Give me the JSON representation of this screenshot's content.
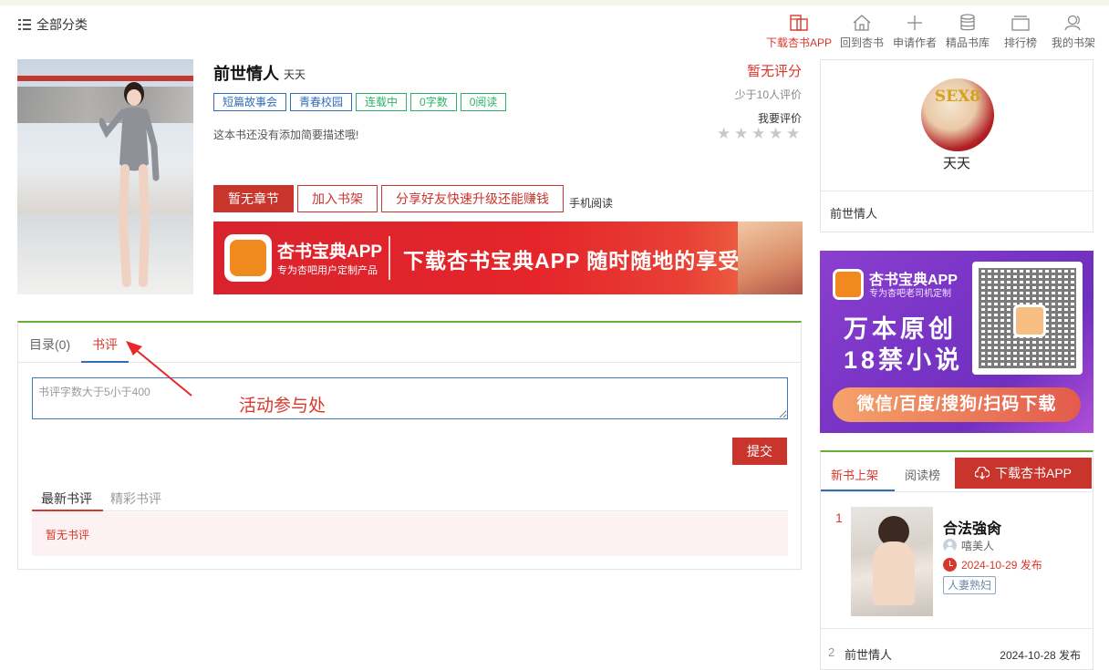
{
  "header": {
    "category_label": "全部分类",
    "nav": [
      {
        "label": "下载杏书APP",
        "icon": "app-icon"
      },
      {
        "label": "回到杏书",
        "icon": "home-icon"
      },
      {
        "label": "申请作者",
        "icon": "plus-icon"
      },
      {
        "label": "精品书库",
        "icon": "database-icon"
      },
      {
        "label": "排行榜",
        "icon": "ranking-icon"
      },
      {
        "label": "我的书架",
        "icon": "user-icon"
      }
    ]
  },
  "book": {
    "title": "前世情人",
    "author": "天天",
    "tags": [
      "短篇故事会",
      "青春校园",
      "连载中",
      "0字数",
      "0阅读"
    ],
    "description": "这本书还没有添加简要描述哦!",
    "score": "暂无评分",
    "rating_note": "少于10人评价",
    "rate_label": "我要评价",
    "stars": 5,
    "buttons": {
      "no_chapters": "暂无章节",
      "add_shelf": "加入书架",
      "share": "分享好友快速升级还能赚钱",
      "mobile": "手机阅读"
    }
  },
  "banner": {
    "app_name": "杏书宝典APP",
    "subtitle": "专为杏吧用户定制产品",
    "slogan": "下载杏书宝典APP 随时随地的享受"
  },
  "review": {
    "tabs": [
      "目录(0)",
      "书评"
    ],
    "placeholder": "书评字数大于5小于400",
    "annotation": "活动参与处",
    "submit_label": "提交",
    "subtabs": [
      "最新书评",
      "精彩书评"
    ],
    "empty_text": "暂无书评"
  },
  "author_box": {
    "avatar_text": "SEX8",
    "name": "天天",
    "book": "前世情人"
  },
  "ad": {
    "app_name": "杏书宝典APP",
    "subtitle": "专为杏吧老司机定制",
    "line1": "万本原创",
    "line2": "18禁小说",
    "bottom": "微信/百度/搜狗/扫码下载"
  },
  "rank": {
    "tabs": [
      "新书上架",
      "阅读榜"
    ],
    "download_label": "下载杏书APP",
    "items": [
      {
        "num": "1",
        "name": "合法強肏",
        "author": "嘻美人",
        "date": "2024-10-29 发布",
        "tag": "人妻熟妇"
      },
      {
        "num": "2",
        "name": "前世情人",
        "date": "2024-10-28 发布"
      }
    ]
  },
  "colors": {
    "accent_red": "#c9352c",
    "link_blue": "#2f6db5",
    "tag_green": "#2cb26a",
    "panel_green": "#69ad36"
  }
}
